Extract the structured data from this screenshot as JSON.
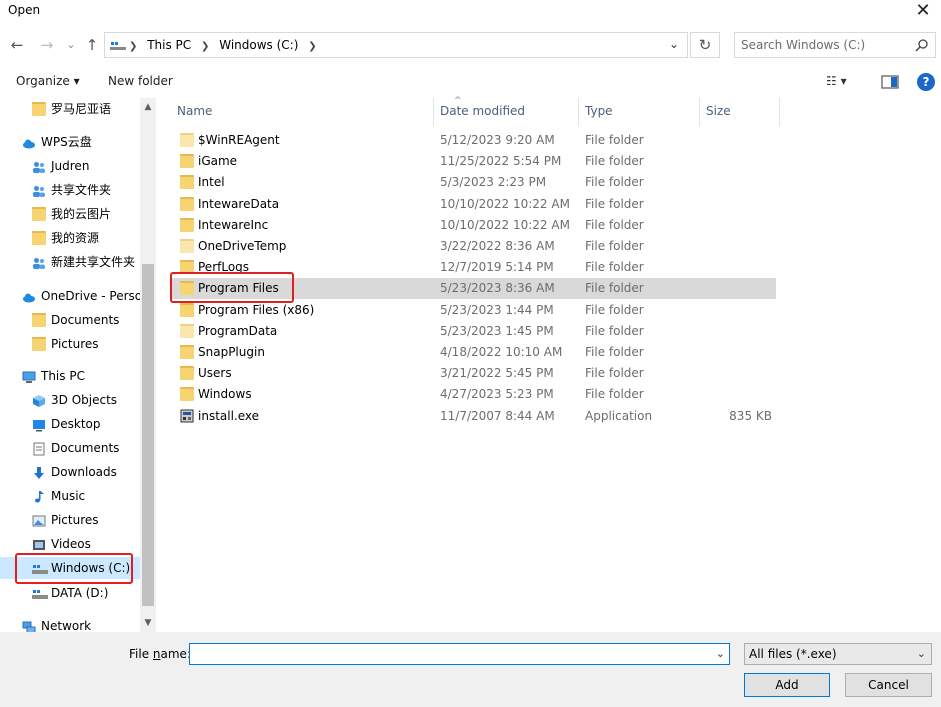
{
  "window": {
    "title": "Open",
    "close_glyph": "✕"
  },
  "nav": {
    "back_glyph": "←",
    "forward_glyph": "→",
    "recent_glyph": "⌄",
    "up_glyph": "↑",
    "breadcrumb": [
      "This PC",
      "Windows (C:)"
    ],
    "refresh_glyph": "↻",
    "search_placeholder": "Search Windows (C:)"
  },
  "toolbar": {
    "organize": "Organize ▾",
    "new_folder": "New folder",
    "view_glyph": "☷ ▾"
  },
  "sidebar": {
    "items": [
      {
        "label": "罗马尼亚语",
        "icon": "folder-icon",
        "indent": 32
      },
      {
        "label": "WPS云盘",
        "icon": "cloud-icon",
        "indent": 22
      },
      {
        "label": "Judren",
        "icon": "people-icon",
        "indent": 32
      },
      {
        "label": "共享文件夹",
        "icon": "people-icon",
        "indent": 32
      },
      {
        "label": "我的云图片",
        "icon": "folder-icon",
        "indent": 32
      },
      {
        "label": "我的资源",
        "icon": "folder-icon",
        "indent": 32
      },
      {
        "label": "新建共享文件夹",
        "icon": "people-icon",
        "indent": 32
      },
      {
        "label": "OneDrive - Personal",
        "icon": "cloud-icon",
        "indent": 22
      },
      {
        "label": "Documents",
        "icon": "folder-icon",
        "indent": 32
      },
      {
        "label": "Pictures",
        "icon": "folder-icon",
        "indent": 32
      },
      {
        "label": "This PC",
        "icon": "pc-icon",
        "indent": 22
      },
      {
        "label": "3D Objects",
        "icon": "cube-icon",
        "indent": 32
      },
      {
        "label": "Desktop",
        "icon": "desktop-icon",
        "indent": 32
      },
      {
        "label": "Documents",
        "icon": "document-icon",
        "indent": 32
      },
      {
        "label": "Downloads",
        "icon": "download-icon",
        "indent": 32
      },
      {
        "label": "Music",
        "icon": "music-icon",
        "indent": 32
      },
      {
        "label": "Pictures",
        "icon": "picture-icon",
        "indent": 32
      },
      {
        "label": "Videos",
        "icon": "video-icon",
        "indent": 32
      },
      {
        "label": "Windows (C:)",
        "icon": "drive-icon",
        "indent": 32,
        "selected": true
      },
      {
        "label": "DATA (D:)",
        "icon": "drive-icon",
        "indent": 32
      },
      {
        "label": "Network",
        "icon": "network-icon",
        "indent": 22
      }
    ]
  },
  "file_list": {
    "columns": [
      "Name",
      "Date modified",
      "Type",
      "Size"
    ],
    "rows": [
      {
        "name": "$WinREAgent",
        "date": "5/12/2023 9:20 AM",
        "type": "File folder",
        "size": "",
        "icon": "folder-light-icon"
      },
      {
        "name": "iGame",
        "date": "11/25/2022 5:54 PM",
        "type": "File folder",
        "size": "",
        "icon": "folder-icon"
      },
      {
        "name": "Intel",
        "date": "5/3/2023 2:23 PM",
        "type": "File folder",
        "size": "",
        "icon": "folder-icon"
      },
      {
        "name": "IntewareData",
        "date": "10/10/2022 10:22 AM",
        "type": "File folder",
        "size": "",
        "icon": "folder-icon"
      },
      {
        "name": "IntewareInc",
        "date": "10/10/2022 10:22 AM",
        "type": "File folder",
        "size": "",
        "icon": "folder-icon"
      },
      {
        "name": "OneDriveTemp",
        "date": "3/22/2022 8:36 AM",
        "type": "File folder",
        "size": "",
        "icon": "folder-light-icon"
      },
      {
        "name": "PerfLogs",
        "date": "12/7/2019 5:14 PM",
        "type": "File folder",
        "size": "",
        "icon": "folder-icon"
      },
      {
        "name": "Program Files",
        "date": "5/23/2023 8:36 AM",
        "type": "File folder",
        "size": "",
        "icon": "folder-icon",
        "selected": true
      },
      {
        "name": "Program Files (x86)",
        "date": "5/23/2023 1:44 PM",
        "type": "File folder",
        "size": "",
        "icon": "folder-icon"
      },
      {
        "name": "ProgramData",
        "date": "5/23/2023 1:45 PM",
        "type": "File folder",
        "size": "",
        "icon": "folder-light-icon"
      },
      {
        "name": "SnapPlugin",
        "date": "4/18/2022 10:10 AM",
        "type": "File folder",
        "size": "",
        "icon": "folder-icon"
      },
      {
        "name": "Users",
        "date": "3/21/2022 5:45 PM",
        "type": "File folder",
        "size": "",
        "icon": "folder-icon"
      },
      {
        "name": "Windows",
        "date": "4/27/2023 5:23 PM",
        "type": "File folder",
        "size": "",
        "icon": "folder-icon"
      },
      {
        "name": "install.exe",
        "date": "11/7/2007 8:44 AM",
        "type": "Application",
        "size": "835 KB",
        "icon": "application-icon"
      }
    ]
  },
  "bottom": {
    "file_name_label_pre": "File ",
    "file_name_label_u": "n",
    "file_name_label_post": "ame:",
    "file_name_value": "",
    "filter_value": "All files (*.exe)",
    "add_label": "Add",
    "cancel_label": "Cancel"
  },
  "colors": {
    "accent": "#0078d7",
    "highlight_annotation": "#e02020",
    "selected_row": "#d9d9d9",
    "folder": "#f7d472"
  }
}
